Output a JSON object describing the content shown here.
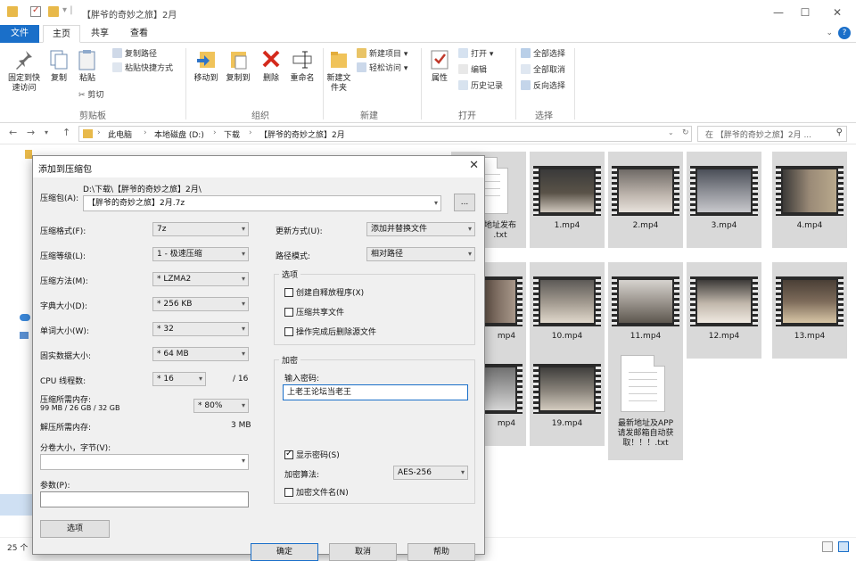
{
  "window": {
    "title": "【胖爷的奇妙之旅】2月",
    "min_glyph": "—",
    "max_glyph": "☐",
    "close_glyph": "✕"
  },
  "ribbon": {
    "tabs": [
      "文件",
      "主页",
      "共享",
      "查看"
    ],
    "clipboard": {
      "pin": "固定到快速访问",
      "copy": "复制",
      "paste": "粘贴",
      "copy_path": "复制路径",
      "paste_shortcut": "粘贴快捷方式",
      "cut": "剪切",
      "group": "剪贴板"
    },
    "organize": {
      "move_to": "移动到",
      "copy_to": "复制到",
      "delete": "删除",
      "rename": "重命名",
      "group": "组织"
    },
    "new": {
      "new_folder": "新建文件夹",
      "new_item": "新建项目",
      "easy_access": "轻松访问",
      "group": "新建"
    },
    "open": {
      "properties": "属性",
      "open": "打开",
      "edit": "编辑",
      "history": "历史记录",
      "group": "打开"
    },
    "select": {
      "select_all": "全部选择",
      "select_none": "全部取消",
      "invert": "反向选择",
      "group": "选择"
    }
  },
  "address": {
    "crumbs": [
      "此电脑",
      "本地磁盘 (D:)",
      "下载",
      "【胖爷的奇妙之旅】2月"
    ],
    "search_placeholder": "在 【胖爷的奇妙之旅】2月 ..."
  },
  "files": [
    {
      "name": "地址发布\n.txt",
      "kind": "doc"
    },
    {
      "name": "1.mp4",
      "kind": "video"
    },
    {
      "name": "2.mp4",
      "kind": "video"
    },
    {
      "name": "3.mp4",
      "kind": "video"
    },
    {
      "name": "4.mp4",
      "kind": "video"
    },
    {
      "name": "mp4",
      "kind": "video"
    },
    {
      "name": "10.mp4",
      "kind": "video"
    },
    {
      "name": "11.mp4",
      "kind": "video"
    },
    {
      "name": "12.mp4",
      "kind": "video"
    },
    {
      "name": "13.mp4",
      "kind": "video"
    },
    {
      "name": "mp4",
      "kind": "video"
    },
    {
      "name": "19.mp4",
      "kind": "video"
    },
    {
      "name": "最新地址及APP请发邮箱自动获取！！！.txt",
      "kind": "doc"
    }
  ],
  "status": {
    "items": "25 个"
  },
  "dialog": {
    "title": "添加到压缩包",
    "archive_label": "压缩包(A):",
    "archive_path": "D:\\下载\\【胖爷的奇妙之旅】2月\\",
    "archive_name": "【胖爷的奇妙之旅】2月.7z",
    "browse": "...",
    "format_label": "压缩格式(F):",
    "format_value": "7z",
    "level_label": "压缩等级(L):",
    "level_value": "1 - 极速压缩",
    "method_label": "压缩方法(M):",
    "method_value": "* LZMA2",
    "dict_label": "字典大小(D):",
    "dict_value": "* 256 KB",
    "word_label": "单词大小(W):",
    "word_value": "* 32",
    "solid_label": "固实数据大小:",
    "solid_value": "* 64 MB",
    "cpu_label": "CPU 线程数:",
    "cpu_value": "* 16",
    "cpu_max": "/ 16",
    "mem_label": "压缩所需内存:",
    "mem_detail": "99 MB / 26 GB / 32 GB",
    "mem_value": "* 80%",
    "decomp_label": "解压所需内存:",
    "decomp_value": "3 MB",
    "split_label": "分卷大小，字节(V):",
    "params_label": "参数(P):",
    "options_btn": "选项",
    "update_label": "更新方式(U):",
    "update_value": "添加并替换文件",
    "pathmode_label": "路径模式:",
    "pathmode_value": "相对路径",
    "options_legend": "选项",
    "opt_sfx": "创建自释放程序(X)",
    "opt_shared": "压缩共享文件",
    "opt_delete": "操作完成后删除源文件",
    "enc_legend": "加密",
    "pwd_label": "输入密码:",
    "pwd_value": "上老王论坛当老王",
    "show_pwd": "显示密码(S)",
    "enc_method_label": "加密算法:",
    "enc_method_value": "AES-256",
    "enc_names": "加密文件名(N)",
    "ok": "确定",
    "cancel": "取消",
    "help": "帮助"
  },
  "colors": {
    "accent": "#1a6fc9",
    "tile_bg": "#d9d9d9",
    "dialog_bg": "#f0f0f0"
  }
}
